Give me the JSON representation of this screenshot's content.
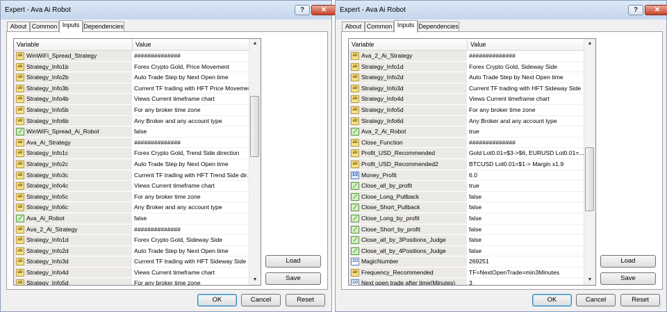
{
  "left": {
    "title": "Expert - Ava Ai Robot",
    "help": "?",
    "close": "✕",
    "tabs": [
      "About",
      "Common",
      "Inputs",
      "Dependencies"
    ],
    "columns": {
      "variable": "Variable",
      "value": "Value"
    },
    "rows": [
      {
        "icon": "ab",
        "name": "WinWiFi_Spread_Strategy",
        "value": "##############"
      },
      {
        "icon": "ab",
        "name": "Strategy_Info1b",
        "value": "Forex Crypto Gold, Price Movement"
      },
      {
        "icon": "ab",
        "name": "Strategy_Info2b",
        "value": "Auto Trade Step by Next Open time"
      },
      {
        "icon": "ab",
        "name": "Strategy_Info3b",
        "value": "Current TF trading with HFT Price Movement"
      },
      {
        "icon": "ab",
        "name": "Strategy_Info4b",
        "value": "Views Current timeframe chart"
      },
      {
        "icon": "ab",
        "name": "Strategy_Info5b",
        "value": "For any broker time zone"
      },
      {
        "icon": "ab",
        "name": "Strategy_Info6b",
        "value": "Any Broker and any account type"
      },
      {
        "icon": "bool",
        "name": "WinWiFi_Spread_Ai_Robot",
        "value": "false"
      },
      {
        "icon": "ab",
        "name": "Ava_Ai_Strategy",
        "value": "##############"
      },
      {
        "icon": "ab",
        "name": "Strategy_Info1c",
        "value": "Forex Crypto Gold, Trend Side direction"
      },
      {
        "icon": "ab",
        "name": "Strategy_Info2c",
        "value": "Auto Trade Step by Next Open time"
      },
      {
        "icon": "ab",
        "name": "Strategy_Info3c",
        "value": "Current TF trading with HFT Trend Side dir..."
      },
      {
        "icon": "ab",
        "name": "Strategy_Info4c",
        "value": "Views Current timeframe chart"
      },
      {
        "icon": "ab",
        "name": "Strategy_Info5c",
        "value": "For any broker time zone"
      },
      {
        "icon": "ab",
        "name": "Strategy_Info6c",
        "value": "Any Broker and any account type"
      },
      {
        "icon": "bool",
        "name": "Ava_Ai_Robot",
        "value": "false"
      },
      {
        "icon": "ab",
        "name": "Ava_2_Ai_Strategy",
        "value": "##############"
      },
      {
        "icon": "ab",
        "name": "Strategy_Info1d",
        "value": "Forex Crypto Gold, Sideway Side"
      },
      {
        "icon": "ab",
        "name": "Strategy_Info2d",
        "value": "Auto Trade Step by Next Open time"
      },
      {
        "icon": "ab",
        "name": "Strategy_Info3d",
        "value": "Current TF trading with HFT Sideway Side"
      },
      {
        "icon": "ab",
        "name": "Strategy_Info4d",
        "value": "Views Current timeframe chart"
      },
      {
        "icon": "ab",
        "name": "Strategy_Info5d",
        "value": "For any broker time zone"
      }
    ],
    "buttons": {
      "load": "Load",
      "save": "Save",
      "ok": "OK",
      "cancel": "Cancel",
      "reset": "Reset"
    }
  },
  "right": {
    "title": "Expert - Ava Ai Robot",
    "help": "?",
    "close": "✕",
    "tabs": [
      "About",
      "Common",
      "Inputs",
      "Dependencies"
    ],
    "columns": {
      "variable": "Variable",
      "value": "Value"
    },
    "rows": [
      {
        "icon": "ab",
        "name": "Ava_2_Ai_Strategy",
        "value": "##############"
      },
      {
        "icon": "ab",
        "name": "Strategy_Info1d",
        "value": "Forex Crypto Gold, Sideway Side"
      },
      {
        "icon": "ab",
        "name": "Strategy_Info2d",
        "value": "Auto Trade Step by Next Open time"
      },
      {
        "icon": "ab",
        "name": "Strategy_Info3d",
        "value": "Current TF trading with HFT Sideway Side"
      },
      {
        "icon": "ab",
        "name": "Strategy_Info4d",
        "value": "Views Current timeframe chart"
      },
      {
        "icon": "ab",
        "name": "Strategy_Info5d",
        "value": "For any broker time zone"
      },
      {
        "icon": "ab",
        "name": "Strategy_Info6d",
        "value": "Any Broker and any account type"
      },
      {
        "icon": "bool",
        "name": "Ava_2_Ai_Robot",
        "value": "true"
      },
      {
        "icon": "ab",
        "name": "Close_Function",
        "value": "##############"
      },
      {
        "icon": "ab",
        "name": "Profit_USD_Recommended",
        "value": "Gold Lot0.01=$3->$6, EURUSD Lot0.01=..."
      },
      {
        "icon": "ab",
        "name": "Profit_USD_Recommended2",
        "value": "BTCUSD Lot0.01=$1-> Margin x1.9"
      },
      {
        "icon": "dbl",
        "name": "Money_Profit",
        "value": "6.0"
      },
      {
        "icon": "bool",
        "name": "Close_all_by_profit",
        "value": "true"
      },
      {
        "icon": "bool",
        "name": "Close_Long_Pullback",
        "value": "false"
      },
      {
        "icon": "bool",
        "name": "Close_Short_Pullback",
        "value": "false"
      },
      {
        "icon": "bool",
        "name": "Close_Long_by_profit",
        "value": "false"
      },
      {
        "icon": "bool",
        "name": "Close_Short_by_profit",
        "value": "false"
      },
      {
        "icon": "bool",
        "name": "Close_all_by_3Positions_Judge",
        "value": "false"
      },
      {
        "icon": "bool",
        "name": "Close_all_by_4Positions_Judge",
        "value": "false"
      },
      {
        "icon": "int",
        "name": "MagicNumber",
        "value": "269251"
      },
      {
        "icon": "ab",
        "name": "Frequency_Recommended",
        "value": "TF=NextOpenTrade=min3Minutes"
      },
      {
        "icon": "int",
        "name": "Next open trade after time(Minutes)",
        "value": "3"
      }
    ],
    "buttons": {
      "load": "Load",
      "save": "Save",
      "ok": "OK",
      "cancel": "Cancel",
      "reset": "Reset"
    }
  },
  "icons": {
    "string": "ab",
    "bool": "bool-icon",
    "double": "1/2",
    "int": "123"
  }
}
